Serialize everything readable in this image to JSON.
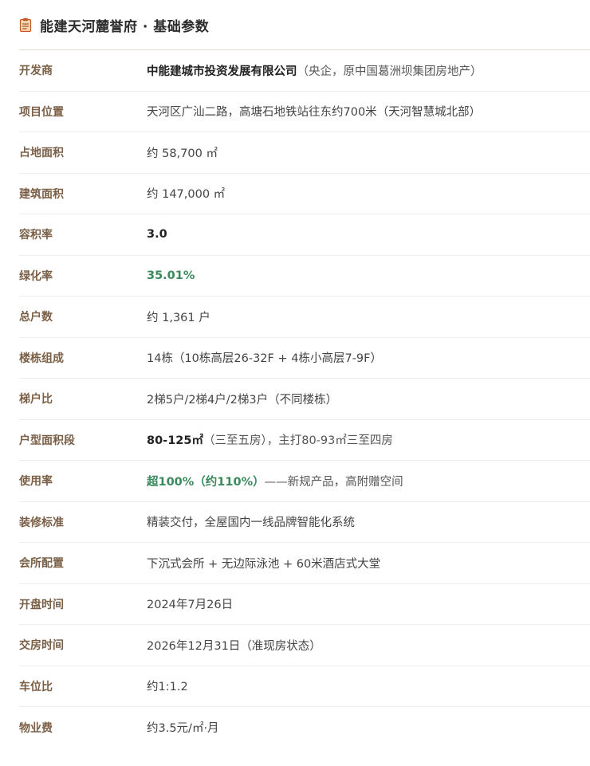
{
  "header": {
    "title": "能建天河麓誉府 · 基础参数",
    "icon": "clipboard-document-icon"
  },
  "colors": {
    "label": "#7a5f46",
    "highlight_green": "#3a8a5c",
    "icon_accent": "#c8552a"
  },
  "rows": [
    {
      "label": "开发商",
      "strong": "中能建城市投资发展有限公司",
      "text": "（央企，原中国葛洲坝集团房地产）"
    },
    {
      "label": "项目位置",
      "text": "天河区广汕二路，高塘石地铁站往东约700米（天河智慧城北部）"
    },
    {
      "label": "占地面积",
      "text": "约 58,700 ㎡"
    },
    {
      "label": "建筑面积",
      "text": "约 147,000 ㎡"
    },
    {
      "label": "容积率",
      "strong": "3.0"
    },
    {
      "label": "绿化率",
      "green": "35.01%"
    },
    {
      "label": "总户数",
      "text": "约 1,361 户"
    },
    {
      "label": "楼栋组成",
      "text": "14栋（10栋高层26-32F + 4栋小高层7-9F）"
    },
    {
      "label": "梯户比",
      "text": "2梯5户/2梯4户/2梯3户（不同楼栋）"
    },
    {
      "label": "户型面积段",
      "strong": "80-125㎡",
      "text": "（三至五房），主打80-93㎡三至四房"
    },
    {
      "label": "使用率",
      "green": "超100%（约110%）",
      "text": "——新规产品，高附赠空间"
    },
    {
      "label": "装修标准",
      "text": "精装交付，全屋国内一线品牌智能化系统"
    },
    {
      "label": "会所配置",
      "text": "下沉式会所 + 无边际泳池 + 60米酒店式大堂"
    },
    {
      "label": "开盘时间",
      "text": "2024年7月26日"
    },
    {
      "label": "交房时间",
      "text": "2026年12月31日（准现房状态）"
    },
    {
      "label": "车位比",
      "text": "约1:1.2"
    },
    {
      "label": "物业费",
      "text": "约3.5元/㎡·月"
    }
  ]
}
